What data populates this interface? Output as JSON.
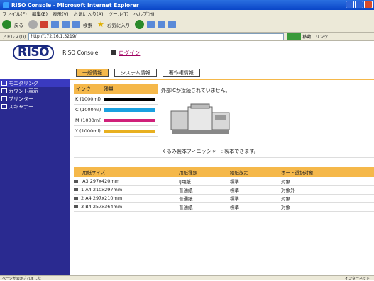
{
  "window": {
    "title": "RISO Console - Microsoft Internet Explorer"
  },
  "menubar": {
    "items": [
      "ファイル(F)",
      "編集(E)",
      "表示(V)",
      "お気に入り(A)",
      "ツール(T)",
      "ヘルプ(H)"
    ]
  },
  "toolbar": {
    "back_label": "戻る",
    "search_label": "検索",
    "favorites_label": "お気に入り"
  },
  "address": {
    "label": "アドレス(D)",
    "url": "http://172.16.1.3219/",
    "go_label": "移動",
    "links_label": "リンク"
  },
  "header": {
    "brand": "RISO",
    "console_label": "RISO Console",
    "login_label": "ログイン"
  },
  "tabs": [
    "一般情報",
    "システム情報",
    "著作権情報"
  ],
  "sidebar": {
    "items": [
      "モニタリング",
      "カウント表示",
      "プリンター",
      "スキャナー"
    ]
  },
  "ink": {
    "col_ink": "インク",
    "col_level": "残量",
    "rows": [
      {
        "label": "K (1000ml)",
        "color": "#000000"
      },
      {
        "label": "C (1000ml)",
        "color": "#1aa0e0"
      },
      {
        "label": "M (1000ml)",
        "color": "#d0207a"
      },
      {
        "label": "Y (1000ml)",
        "color": "#e8b020"
      }
    ]
  },
  "status": {
    "message": "外部ICが接続されていません。",
    "finisher": "くるみ製本フィニッシャー: 製本できます。"
  },
  "paper": {
    "headers": [
      "用紙サイズ",
      "用紙種類",
      "給紙設定",
      "オート選択対象"
    ],
    "rows": [
      {
        "tray": "",
        "size": "A3 297x420mm",
        "type": "IJ用紙",
        "setting": "標準",
        "auto": "対象"
      },
      {
        "tray": "1",
        "size": "A4 210x297mm",
        "type": "普通紙",
        "setting": "標準",
        "auto": "対象外"
      },
      {
        "tray": "2",
        "size": "A4 297x210mm",
        "type": "普通紙",
        "setting": "標準",
        "auto": "対象"
      },
      {
        "tray": "3",
        "size": "B4 257x364mm",
        "type": "普通紙",
        "setting": "標準",
        "auto": "対象"
      }
    ]
  },
  "statusbar": {
    "left": "ページが表示されました",
    "right": "インターネット"
  }
}
